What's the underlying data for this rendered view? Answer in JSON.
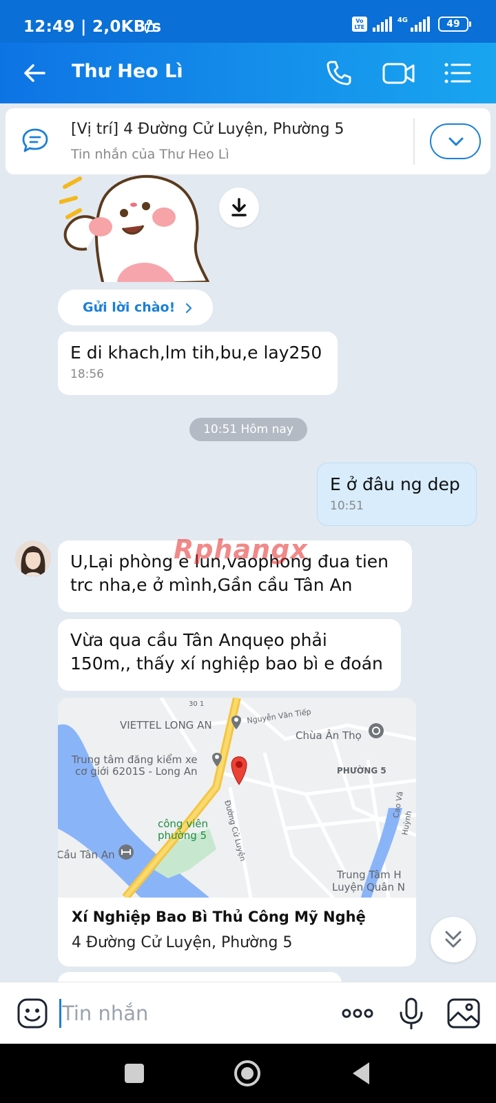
{
  "status_bar": {
    "time": "12:49 | 2,0KB/s",
    "volte": "Vo LTE",
    "network": "4G",
    "battery": "49"
  },
  "header": {
    "title": "Thư Heo Lì",
    "icons": [
      "back-arrow-icon",
      "phone-icon",
      "video-call-icon",
      "menu-list-icon"
    ]
  },
  "pinned": {
    "title": "[Vị trí] 4 Đường Cử Luyện, Phường 5",
    "subtitle": "Tin nhắn của Thư Heo Lì"
  },
  "greet": {
    "label": "Gửi lời chào!"
  },
  "messages": [
    {
      "text": "E di khach,lm tih,bu,e lay250",
      "time": "18:56",
      "side": "left"
    },
    {
      "text": "E ở đâu ng dep",
      "time": "10:51",
      "side": "right"
    },
    {
      "text": "U,Lại phòng e lun,vaophong đua tien trc nha,e ở mình,Gần cầu Tân An",
      "side": "left"
    },
    {
      "text": "Vừa qua cầu  Tân Anquẹo phải 150m,, thấy xí nghiệp bao bì e đoán",
      "side": "left"
    }
  ],
  "date_separator": "10:51 Hôm nay",
  "watermark": "Rphangx",
  "map_card": {
    "place_name": "Xí Nghiệp Bao Bì Thủ Công Mỹ Nghệ",
    "address": "4 Đường Cử Luyện, Phường 5",
    "labels": {
      "viettel": "VIETTEL LONG AN",
      "nguyen_van_tiep": "Nguyễn Văn Tiếp",
      "chua_an_tho": "Chùa Ân Thọ",
      "trung_tam_1": "Trung tâm đăng kiểm xe",
      "trung_tam_2": "cơ giới 6201S - Long An",
      "phuong5": "PHƯỜNG 5",
      "duong_cu_luyen": "Đường Cử Luyện",
      "cong_vien_1": "công viên",
      "cong_vien_2": "phường 5",
      "cau_tan_an": "Cầu Tân An",
      "trung_tam_h1": "Trung Tâm H",
      "trung_tam_h2": "Luyện Quân N",
      "cao_van": "Cao Vă",
      "huynh": "Huỳnh",
      "road_number": "30 1"
    }
  },
  "input": {
    "placeholder": "Tin nhắn"
  },
  "colors": {
    "header": "#0e74e4",
    "accent": "#1a7fd8",
    "chat_bg": "#e2e9f1",
    "own_bubble": "#d8ecfb"
  }
}
